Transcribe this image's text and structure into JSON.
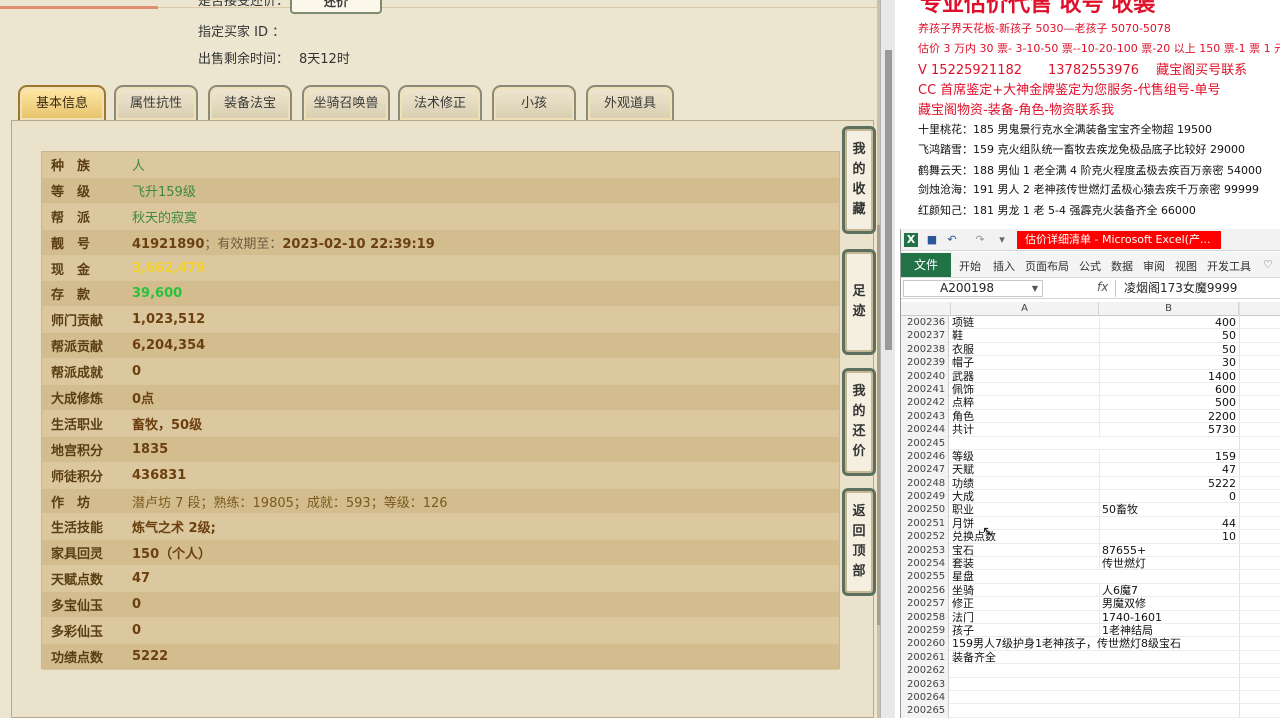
{
  "game": {
    "counter_button": "还价",
    "info_lines": [
      {
        "label": "是否接受还价：",
        "value": ""
      },
      {
        "label": "指定买家 ID ：",
        "value": ""
      },
      {
        "label": "出售剩余时间：",
        "value": "8天12时"
      }
    ],
    "tabs": [
      "基本信息",
      "属性抗性",
      "装备法宝",
      "坐骑召唤兽",
      "法术修正",
      "小孩",
      "外观道具"
    ],
    "active_tab": "基本信息",
    "attributes": [
      {
        "label": "种　族",
        "value": "人"
      },
      {
        "label": "等　级",
        "value": "飞升159级"
      },
      {
        "label": "帮　派",
        "value": "秋天的寂寞"
      },
      {
        "label": "靓　号",
        "value": "41921890",
        "note": "；有效期至：",
        "date": "2023-02-10 22:39:19"
      },
      {
        "label": "现　金",
        "value": "3,662,479"
      },
      {
        "label": "存　款",
        "value": "39,600"
      },
      {
        "label": "师门贡献",
        "value": "1,023,512"
      },
      {
        "label": "帮派贡献",
        "value": "6,204,354"
      },
      {
        "label": "帮派成就",
        "value": "0"
      },
      {
        "label": "大成修炼",
        "value": "0点"
      },
      {
        "label": "生活职业",
        "value": "畜牧，50级"
      },
      {
        "label": "地宫积分",
        "value": "1835"
      },
      {
        "label": "师徒积分",
        "value": "436831"
      },
      {
        "label": "作　坊",
        "value": "潜卢坊 7 段；熟练：19805；成就：593；等级：126"
      },
      {
        "label": "生活技能",
        "value": "炼气之术 2级;"
      },
      {
        "label": "家具回灵",
        "value": "150（个人）"
      },
      {
        "label": "天赋点数",
        "value": "47"
      },
      {
        "label": "多宝仙玉",
        "value": "0"
      },
      {
        "label": "多彩仙玉",
        "value": "0"
      },
      {
        "label": "功绩点数",
        "value": "5222"
      }
    ],
    "side_buttons": [
      "我的收藏",
      "足迹",
      "我的还价",
      "返回顶部"
    ]
  },
  "doc": {
    "title": "专业估价代售 收号 收装",
    "lines": [
      {
        "text": "养孩子界天花板-新孩子 5030—老孩子 5070-5078",
        "style": "red"
      },
      {
        "text": "估价 3 万内 30 票- 3-10-50 票--10-20-100 票-20 以上 150 票-1 票 1 元",
        "style": "red"
      },
      {
        "text": "V 15225921182　　13782553976　 藏宝阁买号联系",
        "style": "red big"
      },
      {
        "text": "CC 首席鉴定+大神金牌鉴定为您服务-代售组号-单号",
        "style": "red big"
      },
      {
        "text": "藏宝阁物资-装备-角色-物资联系我",
        "style": "red big"
      },
      {
        "text": "十里桃花：185 男鬼景行克水全满装备宝宝齐全物超 19500",
        "style": "black"
      },
      {
        "text": "飞鸿踏雪：159 克火组队统一畜牧去疾龙免极品底子比较好 29000",
        "style": "black"
      },
      {
        "text": "鹤舞云天：188 男仙 1 老全满 4 阶克火程度孟极去疾百万亲密 54000",
        "style": "black"
      },
      {
        "text": "剑烛沧海：191 男人 2 老神孩传世燃灯孟极心猿去疾千万亲密 99999",
        "style": "black"
      },
      {
        "text": "红颜知己：181 男龙 1 老 5-4 强霹克火装备齐全 66000",
        "style": "black"
      }
    ]
  },
  "excel": {
    "title": "估价详细清单 - Microsoft Excel(产...",
    "file_tab": "文件",
    "ribbon_tabs": [
      "开始",
      "插入",
      "页面布局",
      "公式",
      "数据",
      "审阅",
      "视图",
      "开发工具"
    ],
    "name_box": "A200198",
    "formula_value": "凌烟阁173女魔9999",
    "columns": [
      "A",
      "B"
    ],
    "rows": [
      {
        "n": "200236",
        "a": "项链",
        "b": "400",
        "num": true
      },
      {
        "n": "200237",
        "a": "鞋",
        "b": "50",
        "num": true
      },
      {
        "n": "200238",
        "a": "衣服",
        "b": "50",
        "num": true
      },
      {
        "n": "200239",
        "a": "帽子",
        "b": "30",
        "num": true
      },
      {
        "n": "200240",
        "a": "武器",
        "b": "1400",
        "num": true
      },
      {
        "n": "200241",
        "a": "佩饰",
        "b": "600",
        "num": true
      },
      {
        "n": "200242",
        "a": "点粹",
        "b": "500",
        "num": true
      },
      {
        "n": "200243",
        "a": "角色",
        "b": "2200",
        "num": true
      },
      {
        "n": "200244",
        "a": "共计",
        "b": "5730",
        "num": true
      },
      {
        "n": "200245",
        "a": "",
        "b": "",
        "num": true
      },
      {
        "n": "200246",
        "a": "等级",
        "b": "159",
        "num": true
      },
      {
        "n": "200247",
        "a": "天赋",
        "b": "47",
        "num": true
      },
      {
        "n": "200248",
        "a": "功绩",
        "b": "5222",
        "num": true
      },
      {
        "n": "200249",
        "a": "大成",
        "b": "0",
        "num": true
      },
      {
        "n": "200250",
        "a": "职业",
        "b": "50畜牧",
        "num": false
      },
      {
        "n": "200251",
        "a": "月饼",
        "b": "44",
        "num": true
      },
      {
        "n": "200252",
        "a": "兑换点数",
        "b": "10",
        "num": true
      },
      {
        "n": "200253",
        "a": "宝石",
        "b": "87655+",
        "num": false
      },
      {
        "n": "200254",
        "a": "套装",
        "b": "传世燃灯",
        "num": false
      },
      {
        "n": "200255",
        "a": "星盘",
        "b": "",
        "num": false
      },
      {
        "n": "200256",
        "a": "坐骑",
        "b": "人6魔7",
        "num": false
      },
      {
        "n": "200257",
        "a": "修正",
        "b": "男魔双修",
        "num": false
      },
      {
        "n": "200258",
        "a": "法门",
        "b": "1740-1601",
        "num": false
      },
      {
        "n": "200259",
        "a": "孩子",
        "b": "1老神结局",
        "num": false
      },
      {
        "n": "200260",
        "a": "159男人7级护身1老神孩子，传世燃灯8级宝石",
        "b": "",
        "num": false
      },
      {
        "n": "200261",
        "a": "装备齐全",
        "b": "",
        "num": false
      },
      {
        "n": "200262",
        "a": "",
        "b": "",
        "num": false
      },
      {
        "n": "200263",
        "a": "",
        "b": "",
        "num": false
      },
      {
        "n": "200264",
        "a": "",
        "b": "",
        "num": false
      },
      {
        "n": "200265",
        "a": "",
        "b": "",
        "num": false
      }
    ]
  }
}
